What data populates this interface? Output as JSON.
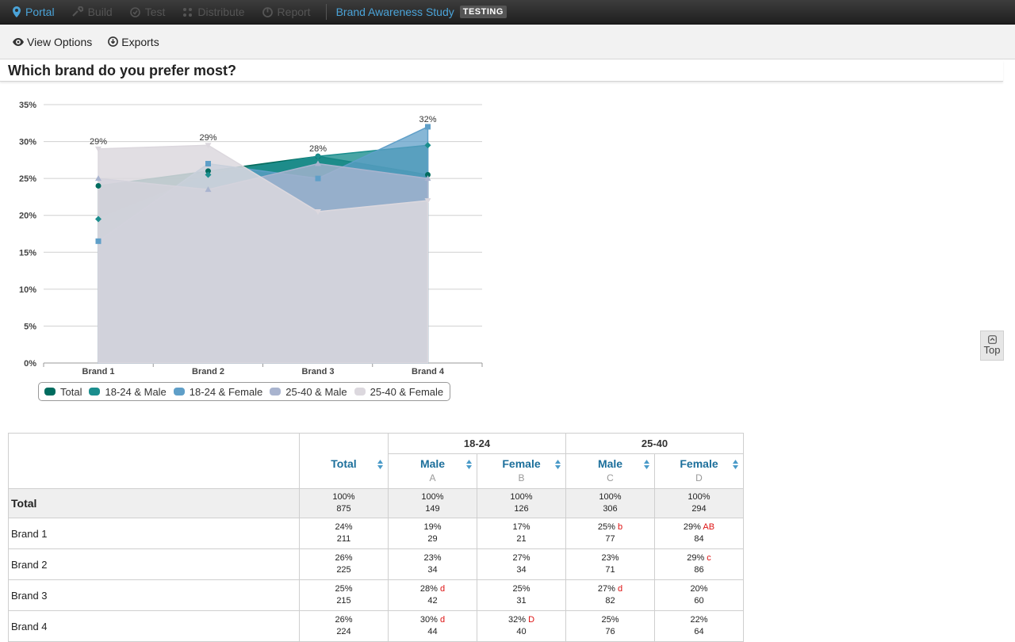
{
  "nav": {
    "items": [
      {
        "label": "Portal",
        "icon": "map-pin-icon"
      },
      {
        "label": "Build",
        "icon": "wrench-icon"
      },
      {
        "label": "Test",
        "icon": "check-circle-icon"
      },
      {
        "label": "Distribute",
        "icon": "share-icon"
      },
      {
        "label": "Report",
        "icon": "pie-chart-icon"
      }
    ],
    "study_title": "Brand Awareness Study",
    "status_badge": "TESTING"
  },
  "toolbar": {
    "view_options": "View Options",
    "exports": "Exports"
  },
  "question": {
    "title": "Which brand do you prefer most?"
  },
  "top_button": {
    "label": "Top"
  },
  "colors": {
    "accent": "#4aa3d8",
    "significance": "#dd1111",
    "column_header": "#1c6f9b"
  },
  "chart_data": {
    "type": "area",
    "categories": [
      "Brand 1",
      "Brand 2",
      "Brand 3",
      "Brand 4"
    ],
    "ylim": [
      0,
      35
    ],
    "yticks": [
      "0%",
      "5%",
      "10%",
      "15%",
      "20%",
      "25%",
      "30%",
      "35%"
    ],
    "grid": true,
    "legend_position": "bottom-left",
    "series": [
      {
        "name": "Total",
        "values": [
          24,
          26,
          28,
          25.5
        ],
        "color": "#006c5f",
        "marker": "circle"
      },
      {
        "name": "18-24 & Male",
        "values": [
          19.5,
          25.5,
          28,
          29.5
        ],
        "color": "#1b8e8e",
        "marker": "diamond"
      },
      {
        "name": "18-24 & Female",
        "values": [
          16.5,
          27,
          25,
          32
        ],
        "color": "#5f9fc8",
        "marker": "square"
      },
      {
        "name": "25-40 & Male",
        "values": [
          25,
          23.5,
          27,
          25
        ],
        "color": "#a9b4cf",
        "marker": "triangle"
      },
      {
        "name": "25-40 & Female",
        "values": [
          29,
          29.5,
          20.5,
          22
        ],
        "color": "#dcd8de",
        "marker": "triangle-down"
      }
    ],
    "data_labels": [
      {
        "category": "Brand 1",
        "value": 29,
        "text": "29%"
      },
      {
        "category": "Brand 2",
        "value": 29.5,
        "text": "29%"
      },
      {
        "category": "Brand 3",
        "value": 28,
        "text": "28%"
      },
      {
        "category": "Brand 4",
        "value": 32,
        "text": "32%"
      }
    ]
  },
  "table": {
    "groups": [
      "18-24",
      "25-40"
    ],
    "columns": [
      {
        "name": "Total",
        "letter": ""
      },
      {
        "name": "Male",
        "letter": "A"
      },
      {
        "name": "Female",
        "letter": "B"
      },
      {
        "name": "Male",
        "letter": "C"
      },
      {
        "name": "Female",
        "letter": "D"
      }
    ],
    "rows": [
      {
        "label": "Total",
        "cells": [
          {
            "pct": "100%",
            "n": "875",
            "sig": ""
          },
          {
            "pct": "100%",
            "n": "149",
            "sig": ""
          },
          {
            "pct": "100%",
            "n": "126",
            "sig": ""
          },
          {
            "pct": "100%",
            "n": "306",
            "sig": ""
          },
          {
            "pct": "100%",
            "n": "294",
            "sig": ""
          }
        ]
      },
      {
        "label": "Brand 1",
        "cells": [
          {
            "pct": "24%",
            "n": "211",
            "sig": ""
          },
          {
            "pct": "19%",
            "n": "29",
            "sig": ""
          },
          {
            "pct": "17%",
            "n": "21",
            "sig": ""
          },
          {
            "pct": "25%",
            "n": "77",
            "sig": "b"
          },
          {
            "pct": "29%",
            "n": "84",
            "sig": "AB"
          }
        ]
      },
      {
        "label": "Brand 2",
        "cells": [
          {
            "pct": "26%",
            "n": "225",
            "sig": ""
          },
          {
            "pct": "23%",
            "n": "34",
            "sig": ""
          },
          {
            "pct": "27%",
            "n": "34",
            "sig": ""
          },
          {
            "pct": "23%",
            "n": "71",
            "sig": ""
          },
          {
            "pct": "29%",
            "n": "86",
            "sig": "c"
          }
        ]
      },
      {
        "label": "Brand 3",
        "cells": [
          {
            "pct": "25%",
            "n": "215",
            "sig": ""
          },
          {
            "pct": "28%",
            "n": "42",
            "sig": "d"
          },
          {
            "pct": "25%",
            "n": "31",
            "sig": ""
          },
          {
            "pct": "27%",
            "n": "82",
            "sig": "d"
          },
          {
            "pct": "20%",
            "n": "60",
            "sig": ""
          }
        ]
      },
      {
        "label": "Brand 4",
        "cells": [
          {
            "pct": "26%",
            "n": "224",
            "sig": ""
          },
          {
            "pct": "30%",
            "n": "44",
            "sig": "d"
          },
          {
            "pct": "32%",
            "n": "40",
            "sig": "D"
          },
          {
            "pct": "25%",
            "n": "76",
            "sig": ""
          },
          {
            "pct": "22%",
            "n": "64",
            "sig": ""
          }
        ]
      }
    ]
  }
}
